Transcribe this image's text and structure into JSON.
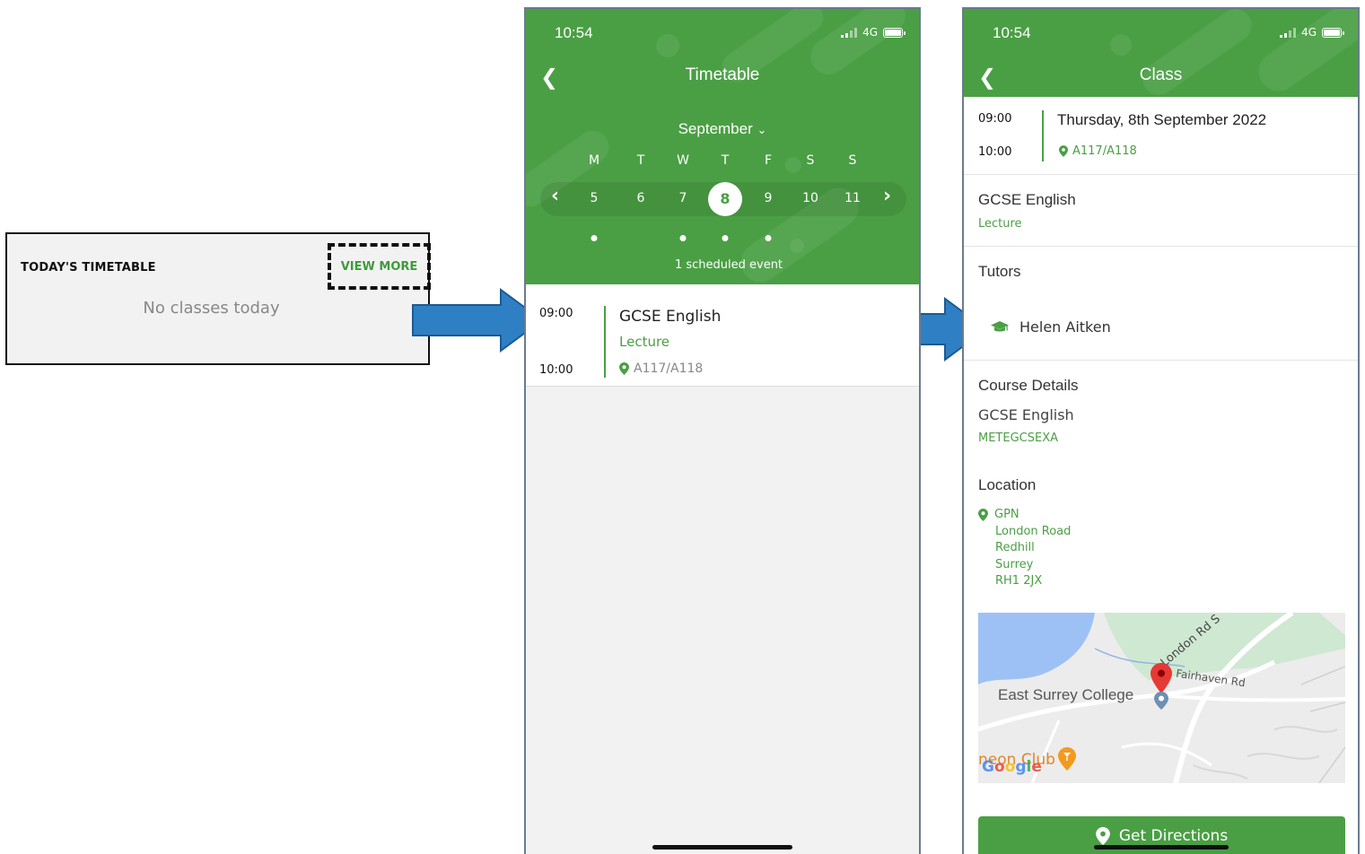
{
  "widget": {
    "title": "TODAY'S TIMETABLE",
    "view_more": "VIEW MORE",
    "empty_text": "No classes today"
  },
  "status": {
    "time": "10:54",
    "network": "4G"
  },
  "timetable": {
    "title": "Timetable",
    "month": "September",
    "day_names": [
      "M",
      "T",
      "W",
      "T",
      "F",
      "S",
      "S"
    ],
    "dates": [
      "5",
      "6",
      "7",
      "8",
      "9",
      "10",
      "11"
    ],
    "selected_date": "8",
    "scheduled_text": "1 scheduled event",
    "event": {
      "start": "09:00",
      "end": "10:00",
      "title": "GCSE English",
      "type": "Lecture",
      "room": "A117/A118"
    }
  },
  "class": {
    "title": "Class",
    "start": "09:00",
    "end": "10:00",
    "date": "Thursday, 8th September 2022",
    "room": "A117/A118",
    "course_title": "GCSE English",
    "course_type": "Lecture",
    "tutors_label": "Tutors",
    "tutor_name": "Helen Aitken",
    "course_details_label": "Course Details",
    "course_name": "GCSE English",
    "course_code": "METEGCSEXA",
    "location_label": "Location",
    "location_name": "GPN",
    "address_lines": [
      "London Road",
      "Redhill",
      "Surrey",
      "RH1 2JX"
    ],
    "map": {
      "road_label": "London Rd S",
      "road2_label": "Fairhaven Rd",
      "place_label": "East Surrey College",
      "poi_label": "neon Club",
      "provider": "Google"
    },
    "directions_button": "Get Directions"
  },
  "colors": {
    "brand_green": "#4a9f44",
    "arrow_blue": "#2f7fc4"
  }
}
